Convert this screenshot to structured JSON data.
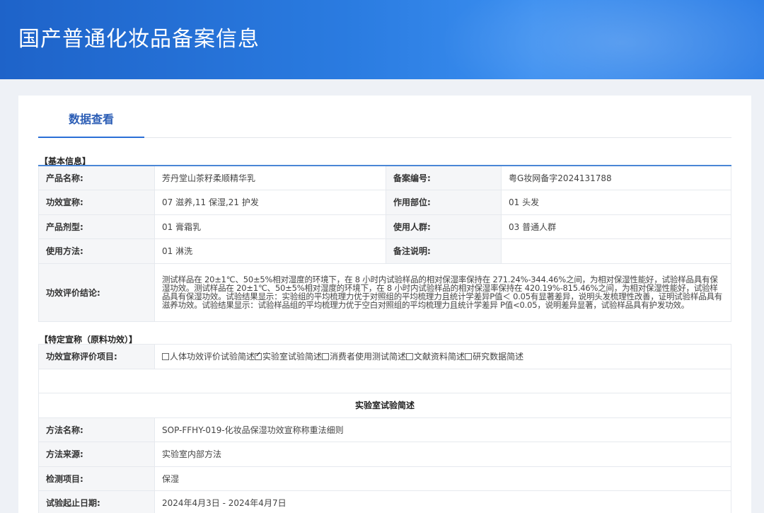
{
  "header": {
    "title": "国产普通化妆品备案信息"
  },
  "tabs": [
    {
      "label": "数据查看",
      "active": true
    }
  ],
  "basic": {
    "section_title": "【基本信息】",
    "product_name_label": "产品名称:",
    "product_name": "芳丹堂山茶籽柔顺精华乳",
    "record_no_label": "备案编号:",
    "record_no": "粤G妆网备字2024131788",
    "claims_label": "功效宣称:",
    "claims": "07 滋养,11 保湿,21 护发",
    "area_label": "作用部位:",
    "area": "01 头发",
    "form_label": "产品剂型:",
    "form": "01 膏霜乳",
    "users_label": "使用人群:",
    "users": "03 普通人群",
    "usage_label": "使用方法:",
    "usage": "01 淋洗",
    "remark_label": "备注说明:",
    "remark": "",
    "conclusion_label": "功效评价结论:",
    "conclusion": "测试样品在 20±1℃、50±5%相对湿度的环境下，在 8 小时内试验样品的相对保湿率保持在 271.24%-344.46%之间，为相对保湿性能好，试验样品具有保湿功效。测试样品在 20±1℃、50±5%相对湿度的环境下，在 8 小时内试验样品的相对保湿率保持在 420.19%-815.46%之间，为相对保湿性能好，试验样品具有保湿功效。试验结果显示：实验组的平均梳理力优于对照组的平均梳理力且统计学差异P值＜ 0.05有显著差异，说明头发梳理性改善，证明试验样品具有滋养功效。试验结果显示：试验样品组的平均梳理力优于空白对照组的平均梳理力且统计学差异 P值<0.05，说明差异显著，试验样品具有护发功效。"
  },
  "specific": {
    "section_title": "【特定宣称（原料功效）】",
    "items_label": "功效宣称评价项目:",
    "options": [
      {
        "label": "人体功效评价试验简述",
        "checked": false
      },
      {
        "label": "实验室试验简述",
        "checked": true
      },
      {
        "label": "消费者使用测试简述",
        "checked": false
      },
      {
        "label": "文献资料简述",
        "checked": false
      },
      {
        "label": "研究数据简述",
        "checked": false
      }
    ],
    "lab_title": "实验室试验简述",
    "method_name_label": "方法名称:",
    "method_name": "SOP-FFHY-019-化妆品保湿功效宣称称重法细则",
    "method_source_label": "方法来源:",
    "method_source": "实验室内部方法",
    "test_item_label": "检测项目:",
    "test_item": "保湿",
    "date_label": "试验起止日期:",
    "date": "2024年4月3日 - 2024年4月7日"
  }
}
